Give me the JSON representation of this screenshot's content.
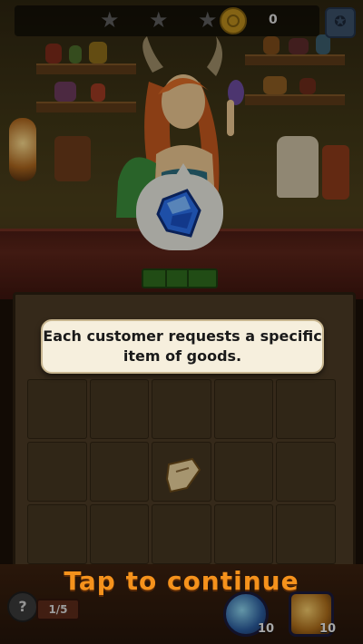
{
  "hud": {
    "stars_total": 3,
    "stars_earned": 0,
    "coins": "0",
    "settings_icon": "star-badge-icon"
  },
  "customer": {
    "request_icon": "blue-gem-icon"
  },
  "tutorial": {
    "message": "Each customer requests a specific item of goods.",
    "continue_prompt": "Tap to continue"
  },
  "board": {
    "columns": 5,
    "rows": 3,
    "items": [
      {
        "name": "parchment-scrap-icon"
      }
    ]
  },
  "footer": {
    "help_label": "?",
    "page_indicator": "1/5",
    "tool_1_count": "10",
    "tool_2_count": "10"
  },
  "colors": {
    "prompt_orange": "#f5921c",
    "gem_blue": "#2a6ee8",
    "tooltip_bg": "#f6efdd"
  }
}
